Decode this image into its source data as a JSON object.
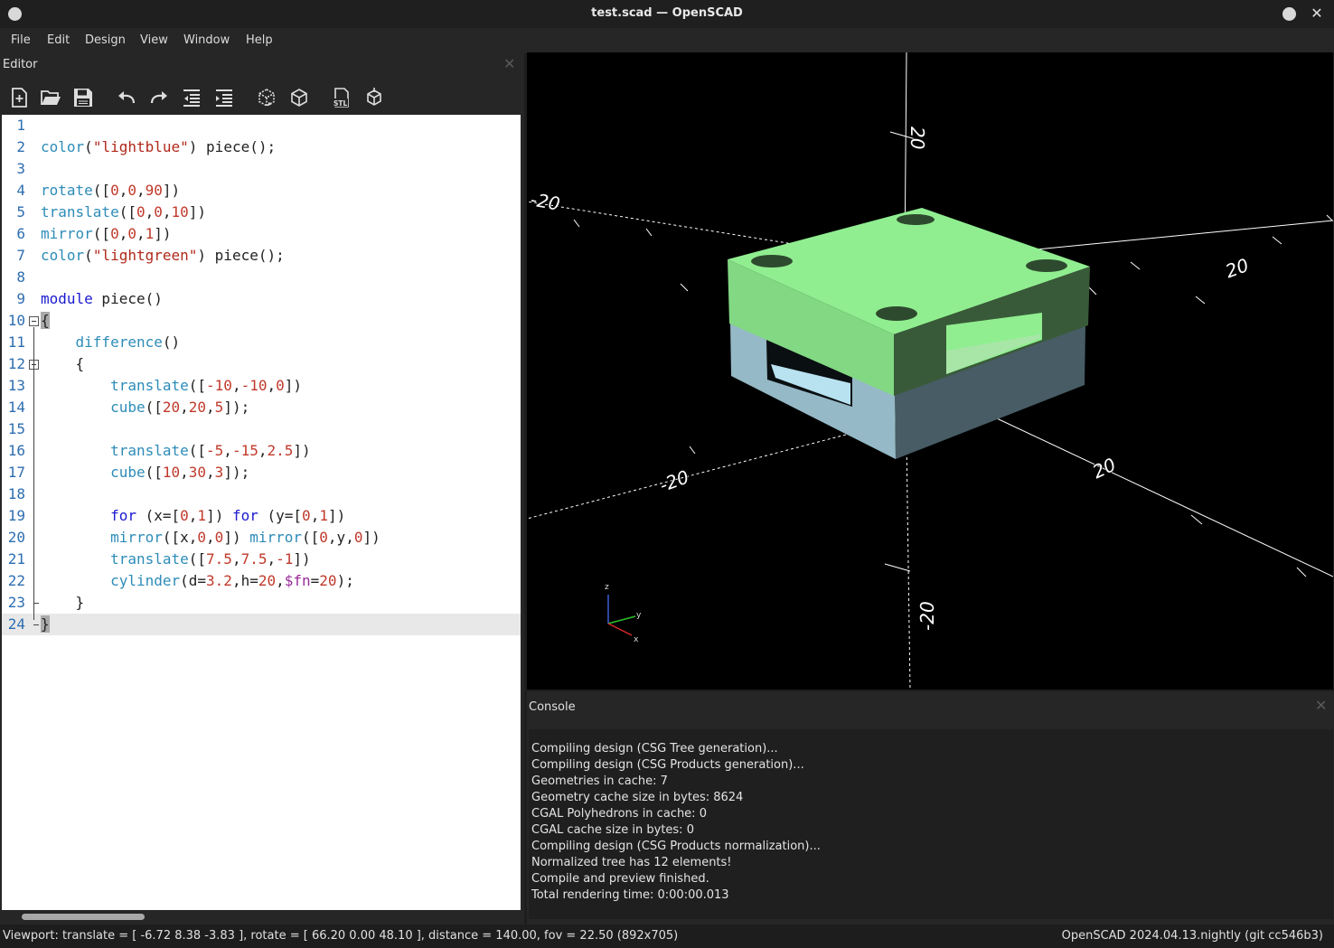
{
  "window": {
    "title": "test.scad — OpenSCAD"
  },
  "menu": [
    "File",
    "Edit",
    "Design",
    "View",
    "Window",
    "Help"
  ],
  "editor": {
    "title": "Editor",
    "toolbar": [
      "new-file-icon",
      "open-file-icon",
      "save-file-icon",
      "undo-icon",
      "redo-icon",
      "unindent-icon",
      "indent-icon",
      "preview-icon",
      "render-icon",
      "export-stl-icon",
      "send-to-print-icon"
    ],
    "stl_label": "STL",
    "lines": [
      {
        "n": "1",
        "t": []
      },
      {
        "n": "2",
        "t": [
          [
            "id",
            "color"
          ],
          [
            "p",
            "("
          ],
          [
            "str",
            "\"lightblue\""
          ],
          [
            "p",
            ") piece();"
          ]
        ]
      },
      {
        "n": "3",
        "t": []
      },
      {
        "n": "4",
        "t": [
          [
            "id",
            "rotate"
          ],
          [
            "p",
            "(["
          ],
          [
            "num",
            "0"
          ],
          [
            "p",
            ","
          ],
          [
            "num",
            "0"
          ],
          [
            "p",
            ","
          ],
          [
            "num",
            "90"
          ],
          [
            "p",
            "])"
          ]
        ]
      },
      {
        "n": "5",
        "t": [
          [
            "id",
            "translate"
          ],
          [
            "p",
            "(["
          ],
          [
            "num",
            "0"
          ],
          [
            "p",
            ","
          ],
          [
            "num",
            "0"
          ],
          [
            "p",
            ","
          ],
          [
            "num",
            "10"
          ],
          [
            "p",
            "])"
          ]
        ]
      },
      {
        "n": "6",
        "t": [
          [
            "id",
            "mirror"
          ],
          [
            "p",
            "(["
          ],
          [
            "num",
            "0"
          ],
          [
            "p",
            ","
          ],
          [
            "num",
            "0"
          ],
          [
            "p",
            ","
          ],
          [
            "num",
            "1"
          ],
          [
            "p",
            "])"
          ]
        ]
      },
      {
        "n": "7",
        "t": [
          [
            "id",
            "color"
          ],
          [
            "p",
            "("
          ],
          [
            "str",
            "\"lightgreen\""
          ],
          [
            "p",
            ") piece();"
          ]
        ]
      },
      {
        "n": "8",
        "t": []
      },
      {
        "n": "9",
        "t": [
          [
            "kw",
            "module"
          ],
          [
            "p",
            " piece()"
          ]
        ]
      },
      {
        "n": "10",
        "t": [
          [
            "brace",
            "{"
          ]
        ]
      },
      {
        "n": "11",
        "t": [
          [
            "p",
            "    "
          ],
          [
            "id",
            "difference"
          ],
          [
            "p",
            "()"
          ]
        ]
      },
      {
        "n": "12",
        "t": [
          [
            "p",
            "    {"
          ]
        ]
      },
      {
        "n": "13",
        "t": [
          [
            "p",
            "        "
          ],
          [
            "id",
            "translate"
          ],
          [
            "p",
            "(["
          ],
          [
            "num",
            "-10"
          ],
          [
            "p",
            ","
          ],
          [
            "num",
            "-10"
          ],
          [
            "p",
            ","
          ],
          [
            "num",
            "0"
          ],
          [
            "p",
            "])"
          ]
        ]
      },
      {
        "n": "14",
        "t": [
          [
            "p",
            "        "
          ],
          [
            "id",
            "cube"
          ],
          [
            "p",
            "(["
          ],
          [
            "num",
            "20"
          ],
          [
            "p",
            ","
          ],
          [
            "num",
            "20"
          ],
          [
            "p",
            ","
          ],
          [
            "num",
            "5"
          ],
          [
            "p",
            "]);"
          ]
        ]
      },
      {
        "n": "15",
        "t": []
      },
      {
        "n": "16",
        "t": [
          [
            "p",
            "        "
          ],
          [
            "id",
            "translate"
          ],
          [
            "p",
            "(["
          ],
          [
            "num",
            "-5"
          ],
          [
            "p",
            ","
          ],
          [
            "num",
            "-15"
          ],
          [
            "p",
            ","
          ],
          [
            "num",
            "2.5"
          ],
          [
            "p",
            "])"
          ]
        ]
      },
      {
        "n": "17",
        "t": [
          [
            "p",
            "        "
          ],
          [
            "id",
            "cube"
          ],
          [
            "p",
            "(["
          ],
          [
            "num",
            "10"
          ],
          [
            "p",
            ","
          ],
          [
            "num",
            "30"
          ],
          [
            "p",
            ","
          ],
          [
            "num",
            "3"
          ],
          [
            "p",
            "]);"
          ]
        ]
      },
      {
        "n": "18",
        "t": []
      },
      {
        "n": "19",
        "t": [
          [
            "p",
            "        "
          ],
          [
            "kw",
            "for"
          ],
          [
            "p",
            " ("
          ],
          [
            "p",
            "x=["
          ],
          [
            "num",
            "0"
          ],
          [
            "p",
            ","
          ],
          [
            "num",
            "1"
          ],
          [
            "p",
            "]) "
          ],
          [
            "kw",
            "for"
          ],
          [
            "p",
            " ("
          ],
          [
            "p",
            "y=["
          ],
          [
            "num",
            "0"
          ],
          [
            "p",
            ","
          ],
          [
            "num",
            "1"
          ],
          [
            "p",
            "])"
          ]
        ]
      },
      {
        "n": "20",
        "t": [
          [
            "p",
            "        "
          ],
          [
            "id",
            "mirror"
          ],
          [
            "p",
            "([x,"
          ],
          [
            "num",
            "0"
          ],
          [
            "p",
            ","
          ],
          [
            "num",
            "0"
          ],
          [
            "p",
            "]) "
          ],
          [
            "id",
            "mirror"
          ],
          [
            "p",
            "(["
          ],
          [
            "num",
            "0"
          ],
          [
            "p",
            ",y,"
          ],
          [
            "num",
            "0"
          ],
          [
            "p",
            "])"
          ]
        ]
      },
      {
        "n": "21",
        "t": [
          [
            "p",
            "        "
          ],
          [
            "id",
            "translate"
          ],
          [
            "p",
            "(["
          ],
          [
            "num",
            "7.5"
          ],
          [
            "p",
            ","
          ],
          [
            "num",
            "7.5"
          ],
          [
            "p",
            ","
          ],
          [
            "num",
            "-1"
          ],
          [
            "p",
            "])"
          ]
        ]
      },
      {
        "n": "22",
        "t": [
          [
            "p",
            "        "
          ],
          [
            "id",
            "cylinder"
          ],
          [
            "p",
            "("
          ],
          [
            "p",
            "d="
          ],
          [
            "num",
            "3.2"
          ],
          [
            "p",
            ",h="
          ],
          [
            "num",
            "20"
          ],
          [
            "p",
            ","
          ],
          [
            "var",
            "$fn"
          ],
          [
            "p",
            "="
          ],
          [
            "num",
            "20"
          ],
          [
            "p",
            ");"
          ]
        ]
      },
      {
        "n": "23",
        "t": [
          [
            "p",
            "    }"
          ]
        ]
      },
      {
        "n": "24",
        "t": [
          [
            "brace",
            "}"
          ]
        ]
      }
    ],
    "current_line": 24
  },
  "viewport": {
    "axis_labels": [
      "20",
      "-20",
      "20",
      "-20",
      "20",
      "-20"
    ],
    "gizmo": {
      "z": "z",
      "y": "y",
      "x": "x"
    },
    "colors": {
      "top_piece": "#90ee90",
      "bottom_piece": "#add8e6",
      "background": "#000000"
    }
  },
  "console": {
    "title": "Console",
    "messages": [
      "Compiling design (CSG Tree generation)...",
      "Compiling design (CSG Products generation)...",
      "Geometries in cache: 7",
      "Geometry cache size in bytes: 8624",
      "CGAL Polyhedrons in cache: 0",
      "CGAL cache size in bytes: 0",
      "Compiling design (CSG Products normalization)...",
      "Normalized tree has 12 elements!",
      "Compile and preview finished.",
      "Total rendering time: 0:00:00.013"
    ]
  },
  "status": {
    "viewport_info": "Viewport: translate = [ -6.72 8.38 -3.83 ], rotate = [ 66.20 0.00 48.10 ], distance = 140.00, fov = 22.50 (892x705)",
    "version": "OpenSCAD 2024.04.13.nightly (git cc546b3)"
  }
}
